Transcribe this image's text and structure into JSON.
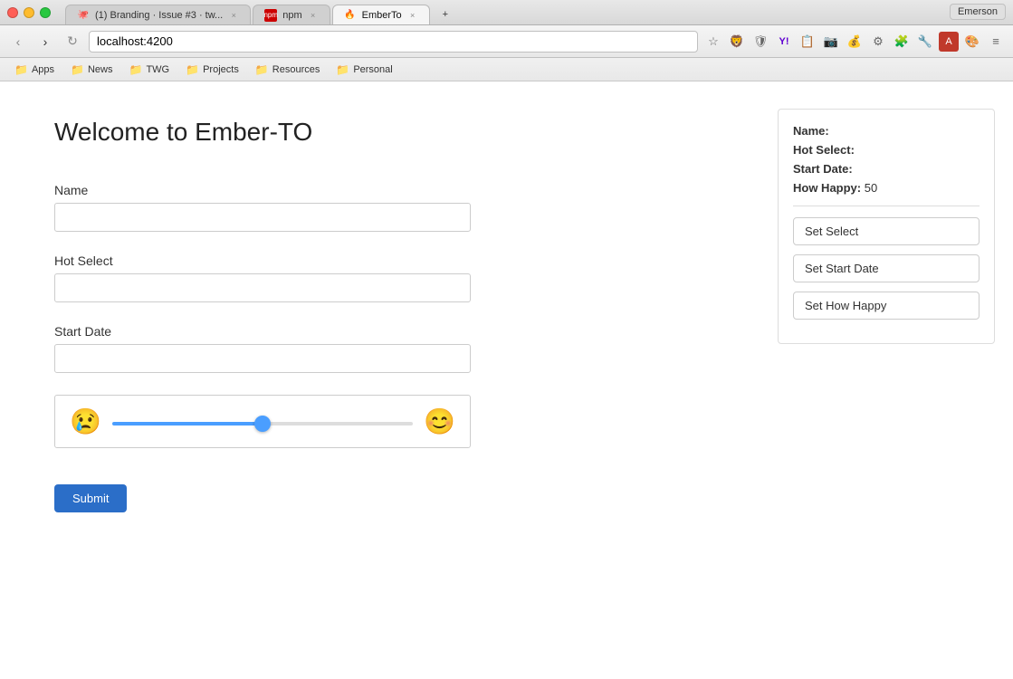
{
  "titlebar": {
    "user": "Emerson"
  },
  "tabs": [
    {
      "id": "tab1",
      "favicon": "🐙",
      "label": "(1) Branding · Issue #3 · tw...",
      "active": false
    },
    {
      "id": "tab2",
      "favicon": "📦",
      "label": "npm",
      "active": false
    },
    {
      "id": "tab3",
      "favicon": "🔥",
      "label": "EmberTo",
      "active": true
    }
  ],
  "toolbar": {
    "address": "localhost:4200"
  },
  "bookmarks": [
    {
      "id": "apps",
      "label": "Apps"
    },
    {
      "id": "news",
      "label": "News"
    },
    {
      "id": "twg",
      "label": "TWG"
    },
    {
      "id": "projects",
      "label": "Projects"
    },
    {
      "id": "resources",
      "label": "Resources"
    },
    {
      "id": "personal",
      "label": "Personal"
    }
  ],
  "page": {
    "title": "Welcome to Ember-TO",
    "form": {
      "name_label": "Name",
      "name_placeholder": "",
      "hot_select_label": "Hot Select",
      "hot_select_placeholder": "",
      "start_date_label": "Start Date",
      "start_date_placeholder": "",
      "slider_value": 50,
      "emoji_sad": "😢",
      "emoji_happy": "😊",
      "submit_label": "Submit"
    },
    "sidebar": {
      "name_label": "Name:",
      "hot_select_label": "Hot Select:",
      "start_date_label": "Start Date:",
      "how_happy_label": "How Happy:",
      "how_happy_value": "50",
      "set_select_label": "Set Select",
      "set_start_date_label": "Set Start Date",
      "set_how_happy_label": "Set How Happy"
    }
  }
}
